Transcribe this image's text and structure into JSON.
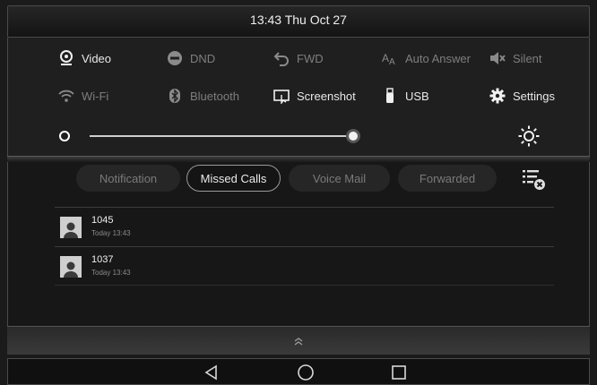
{
  "status_bar": {
    "datetime": "13:43 Thu Oct 27"
  },
  "quick_settings": {
    "row1": [
      {
        "label": "Video",
        "icon": "video-icon",
        "enabled": true
      },
      {
        "label": "DND",
        "icon": "dnd-icon",
        "enabled": false
      },
      {
        "label": "FWD",
        "icon": "forward-icon",
        "enabled": false
      },
      {
        "label": "Auto Answer",
        "icon": "auto-answer-icon",
        "enabled": false
      },
      {
        "label": "Silent",
        "icon": "silent-icon",
        "enabled": false
      }
    ],
    "row2": [
      {
        "label": "Wi-Fi",
        "icon": "wifi-icon",
        "enabled": false
      },
      {
        "label": "Bluetooth",
        "icon": "bluetooth-icon",
        "enabled": false
      },
      {
        "label": "Screenshot",
        "icon": "screenshot-icon",
        "enabled": true
      },
      {
        "label": "USB",
        "icon": "usb-icon",
        "enabled": true
      },
      {
        "label": "Settings",
        "icon": "settings-icon",
        "enabled": true
      }
    ],
    "brightness_level": 0.92
  },
  "tabs": [
    {
      "label": "Notification",
      "active": false
    },
    {
      "label": "Missed Calls",
      "active": true
    },
    {
      "label": "Voice Mail",
      "active": false
    },
    {
      "label": "Forwarded",
      "active": false
    }
  ],
  "missed_calls": [
    {
      "number": "1045",
      "time": "Today 13:43"
    },
    {
      "number": "1037",
      "time": "Today 13:43"
    }
  ],
  "colors": {
    "background": "#1b1b1b",
    "enabled_text": "#e8e8e8",
    "disabled_text": "#7e7e7e"
  }
}
